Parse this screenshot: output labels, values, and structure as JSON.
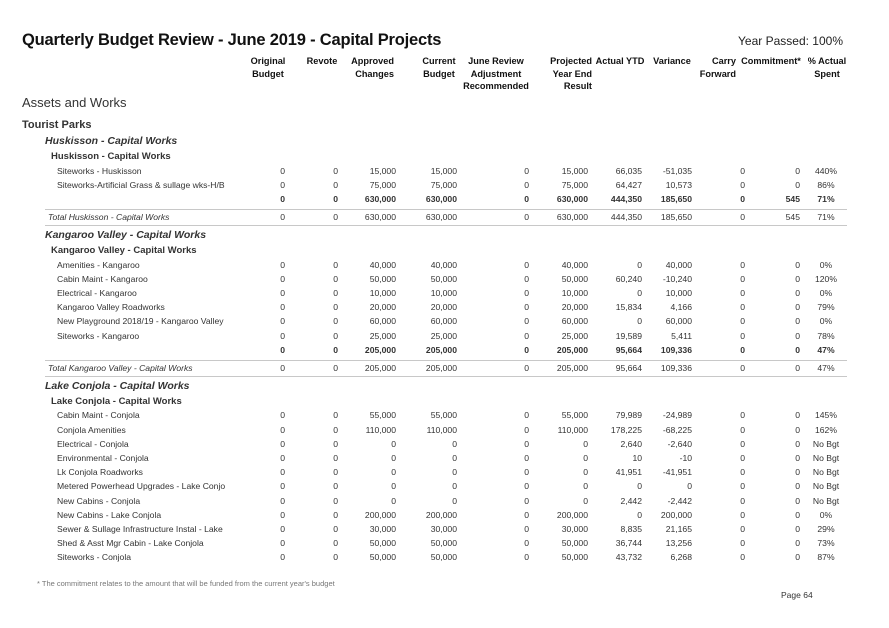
{
  "title": "Quarterly Budget Review - June 2019 - Capital Projects",
  "year_passed": "Year Passed: 100%",
  "columns": [
    "Original Budget",
    "Revote",
    "Approved Changes",
    "Current Budget",
    "June Review Adjustment Recommended",
    "Projected Year End Result",
    "Actual YTD",
    "Variance",
    "Carry Forward",
    "Commitment*",
    "% Actual Spent"
  ],
  "column_lines": [
    [
      "Original",
      "Budget"
    ],
    [
      "Revote"
    ],
    [
      "Approved",
      "Changes"
    ],
    [
      "Current",
      "Budget"
    ],
    [
      "June Review",
      "Adjustment",
      "Recommended"
    ],
    [
      "Projected",
      "Year End",
      "Result"
    ],
    [
      "Actual YTD"
    ],
    [
      "Variance"
    ],
    [
      "Carry",
      "Forward"
    ],
    [
      "Commitment*"
    ],
    [
      "% Actual",
      "Spent"
    ]
  ],
  "section": "Assets and Works",
  "group": "Tourist Parks",
  "blocks": [
    {
      "heading": "Huskisson - Capital Works",
      "subheading": "Huskisson - Capital Works",
      "rows": [
        {
          "label": "Siteworks - Huskisson",
          "values": [
            "0",
            "0",
            "15,000",
            "15,000",
            "0",
            "15,000",
            "66,035",
            "-51,035",
            "0",
            "0",
            "440%"
          ]
        },
        {
          "label": "Siteworks-Artificial Grass & sullage wks-H/B",
          "values": [
            "0",
            "0",
            "75,000",
            "75,000",
            "0",
            "75,000",
            "64,427",
            "10,573",
            "0",
            "0",
            "86%"
          ]
        }
      ],
      "subtotal": [
        "0",
        "0",
        "630,000",
        "630,000",
        "0",
        "630,000",
        "444,350",
        "185,650",
        "0",
        "545",
        "71%"
      ],
      "total_label": "Total Huskisson - Capital Works",
      "total": [
        "0",
        "0",
        "630,000",
        "630,000",
        "0",
        "630,000",
        "444,350",
        "185,650",
        "0",
        "545",
        "71%"
      ]
    },
    {
      "heading": "Kangaroo Valley - Capital Works",
      "subheading": "Kangaroo Valley - Capital Works",
      "rows": [
        {
          "label": "Amenities - Kangaroo",
          "values": [
            "0",
            "0",
            "40,000",
            "40,000",
            "0",
            "40,000",
            "0",
            "40,000",
            "0",
            "0",
            "0%"
          ]
        },
        {
          "label": "Cabin Maint - Kangaroo",
          "values": [
            "0",
            "0",
            "50,000",
            "50,000",
            "0",
            "50,000",
            "60,240",
            "-10,240",
            "0",
            "0",
            "120%"
          ]
        },
        {
          "label": "Electrical - Kangaroo",
          "values": [
            "0",
            "0",
            "10,000",
            "10,000",
            "0",
            "10,000",
            "0",
            "10,000",
            "0",
            "0",
            "0%"
          ]
        },
        {
          "label": "Kangaroo Valley Roadworks",
          "values": [
            "0",
            "0",
            "20,000",
            "20,000",
            "0",
            "20,000",
            "15,834",
            "4,166",
            "0",
            "0",
            "79%"
          ]
        },
        {
          "label": "New Playground 2018/19 - Kangaroo Valley",
          "values": [
            "0",
            "0",
            "60,000",
            "60,000",
            "0",
            "60,000",
            "0",
            "60,000",
            "0",
            "0",
            "0%"
          ]
        },
        {
          "label": "Siteworks - Kangaroo",
          "values": [
            "0",
            "0",
            "25,000",
            "25,000",
            "0",
            "25,000",
            "19,589",
            "5,411",
            "0",
            "0",
            "78%"
          ]
        }
      ],
      "subtotal": [
        "0",
        "0",
        "205,000",
        "205,000",
        "0",
        "205,000",
        "95,664",
        "109,336",
        "0",
        "0",
        "47%"
      ],
      "total_label": "Total Kangaroo Valley - Capital Works",
      "total": [
        "0",
        "0",
        "205,000",
        "205,000",
        "0",
        "205,000",
        "95,664",
        "109,336",
        "0",
        "0",
        "47%"
      ]
    },
    {
      "heading": "Lake Conjola - Capital Works",
      "subheading": "Lake Conjola - Capital Works",
      "rows": [
        {
          "label": "Cabin Maint - Conjola",
          "values": [
            "0",
            "0",
            "55,000",
            "55,000",
            "0",
            "55,000",
            "79,989",
            "-24,989",
            "0",
            "0",
            "145%"
          ]
        },
        {
          "label": "Conjola Amenities",
          "values": [
            "0",
            "0",
            "110,000",
            "110,000",
            "0",
            "110,000",
            "178,225",
            "-68,225",
            "0",
            "0",
            "162%"
          ]
        },
        {
          "label": "Electrical - Conjola",
          "values": [
            "0",
            "0",
            "0",
            "0",
            "0",
            "0",
            "2,640",
            "-2,640",
            "0",
            "0",
            "No Bgt"
          ]
        },
        {
          "label": "Environmental - Conjola",
          "values": [
            "0",
            "0",
            "0",
            "0",
            "0",
            "0",
            "10",
            "-10",
            "0",
            "0",
            "No Bgt"
          ]
        },
        {
          "label": "Lk Conjola Roadworks",
          "values": [
            "0",
            "0",
            "0",
            "0",
            "0",
            "0",
            "41,951",
            "-41,951",
            "0",
            "0",
            "No Bgt"
          ]
        },
        {
          "label": "Metered Powerhead Upgrades - Lake Conjo",
          "values": [
            "0",
            "0",
            "0",
            "0",
            "0",
            "0",
            "0",
            "0",
            "0",
            "0",
            "No Bgt"
          ]
        },
        {
          "label": "New Cabins - Conjola",
          "values": [
            "0",
            "0",
            "0",
            "0",
            "0",
            "0",
            "2,442",
            "-2,442",
            "0",
            "0",
            "No Bgt"
          ]
        },
        {
          "label": "New Cabins - Lake Conjola",
          "values": [
            "0",
            "0",
            "200,000",
            "200,000",
            "0",
            "200,000",
            "0",
            "200,000",
            "0",
            "0",
            "0%"
          ]
        },
        {
          "label": "Sewer & Sullage Infrastructure Instal - Lake",
          "values": [
            "0",
            "0",
            "30,000",
            "30,000",
            "0",
            "30,000",
            "8,835",
            "21,165",
            "0",
            "0",
            "29%"
          ]
        },
        {
          "label": "Shed & Asst Mgr Cabin - Lake Conjola",
          "values": [
            "0",
            "0",
            "50,000",
            "50,000",
            "0",
            "50,000",
            "36,744",
            "13,256",
            "0",
            "0",
            "73%"
          ]
        },
        {
          "label": "Siteworks - Conjola",
          "values": [
            "0",
            "0",
            "50,000",
            "50,000",
            "0",
            "50,000",
            "43,732",
            "6,268",
            "0",
            "0",
            "87%"
          ]
        }
      ]
    }
  ],
  "footnote": "* The commitment relates to the amount that will be funded from the current year's budget",
  "page_number": "Page 64"
}
